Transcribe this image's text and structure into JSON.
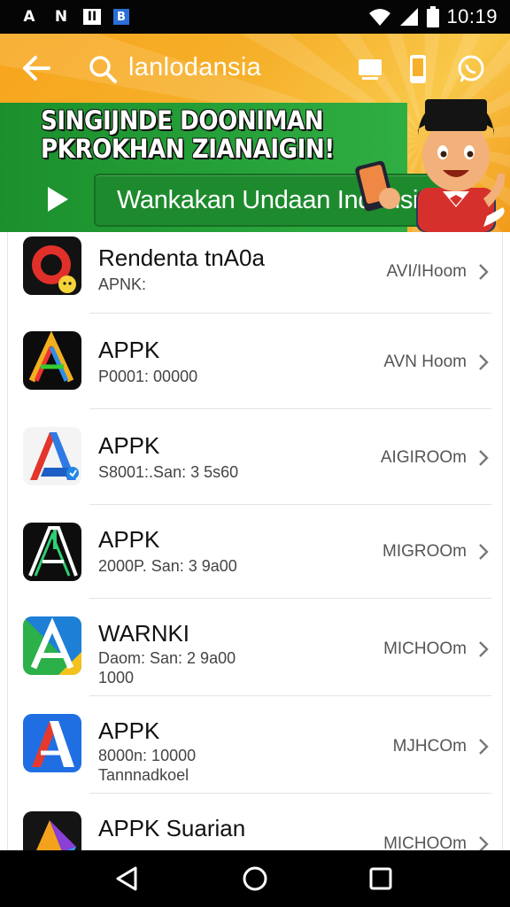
{
  "status_bar": {
    "left_icons": [
      "A",
      "N",
      "II",
      "B"
    ],
    "time": "10:19"
  },
  "header": {
    "search_query": "lanlodansia",
    "promo_title": "SINGIJNDE DOONIMAN\nPKROKHAN ZIANAIGIN!",
    "cta_label": "Wankakan Undaan Indonsia"
  },
  "apps": [
    {
      "name": "Rendenta tnA0a",
      "sub": "APNK:",
      "size": "AVI/IHoom"
    },
    {
      "name": "APPK",
      "sub": "P0001: 00000",
      "size": "AVN Hoom"
    },
    {
      "name": "APPK",
      "sub": "S8001:.San: 3 5s60",
      "size": "AIGIROOm"
    },
    {
      "name": "APPK",
      "sub": "2000P. San: 3 9a00",
      "size": "MIGROOm"
    },
    {
      "name": "WARNKI",
      "sub": "Daom: San: 2 9a00\n1000",
      "size": "MICHOOm"
    },
    {
      "name": "APPK",
      "sub": "8000n: 10000\nTannnadkoel",
      "size": "MJHCOm"
    },
    {
      "name": "APPK Suarian",
      "sub": "",
      "size": "MICHOOm"
    }
  ],
  "colors": {
    "header_orange": "#f7a51c",
    "header_green": "#27a23a",
    "cta_green": "#1e8a2e",
    "status_bar": "#050505",
    "nav_bar": "#000000"
  }
}
